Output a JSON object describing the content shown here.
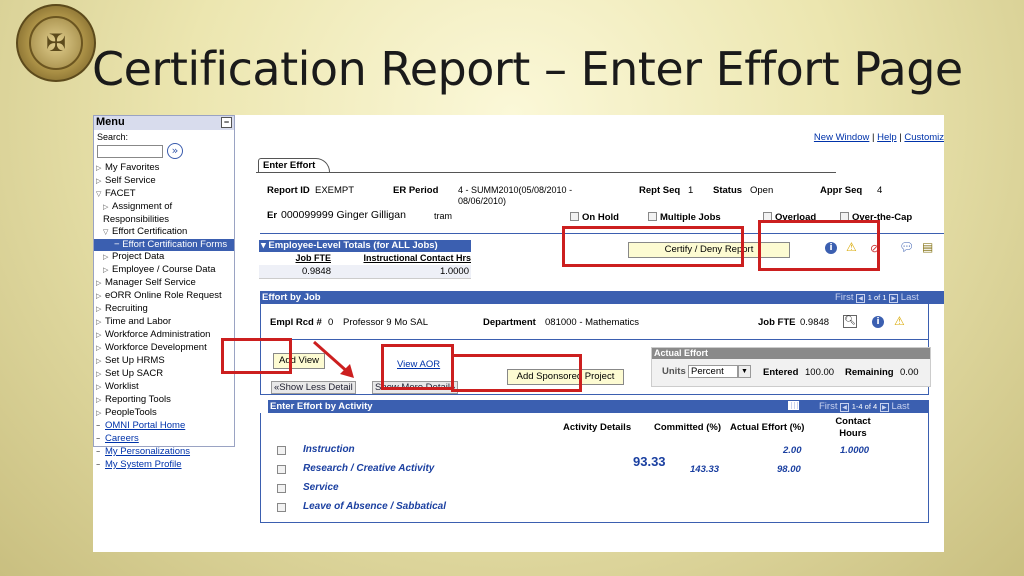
{
  "slide": {
    "title": "Certification Report – Enter Effort Page"
  },
  "menu": {
    "title": "Menu",
    "search_label": "Search:",
    "items": [
      "My Favorites",
      "Self Service",
      "FACET",
      "Assignment of Responsibilities",
      "Effort Certification",
      "Effort Certification Forms",
      "Project Data",
      "Employee / Course Data",
      "Manager Self Service",
      "eORR Online Role Request",
      "Recruiting",
      "Time and Labor",
      "Workforce Administration",
      "Workforce Development",
      "Set Up HRMS",
      "Set Up SACR",
      "Worklist",
      "Reporting Tools",
      "PeopleTools",
      "OMNI Portal Home",
      "Careers",
      "My Personalizations",
      "My System Profile"
    ]
  },
  "top_links": {
    "new_window": "New Window",
    "help": "Help",
    "customize": "Customiz",
    "sep": "|"
  },
  "tab": "Enter Effort",
  "header": {
    "report_id_label": "Report ID",
    "report_id": "EXEMPT",
    "er_period_label": "ER Period",
    "er_period": "4 - SUMM2010(05/08/2010 - 08/06/2010)",
    "rept_seq_label": "Rept Seq",
    "rept_seq": "1",
    "status_label": "Status",
    "status": "Open",
    "appr_seq_label": "Appr Seq",
    "appr_seq": "4",
    "emp_label": "Er",
    "emp_id": "000099999 Ginger Gilligan",
    "emp_suffix": "tram",
    "on_hold": "On Hold",
    "multiple_jobs": "Multiple Jobs",
    "overload": "Overload",
    "over_cap": "Over-the-Cap"
  },
  "totals": {
    "title": "Employee-Level Totals (for ALL Jobs)",
    "col1": "Job FTE",
    "col2": "Instructional Contact Hrs",
    "val1": "0.9848",
    "val2": "1.0000"
  },
  "certify_button": "Certify / Deny Report",
  "effort_by_job": {
    "title": "Effort by Job",
    "pager_first": "First",
    "pager_count": "1 of 1",
    "pager_last": "Last",
    "empl_rcd_label": "Empl Rcd #",
    "empl_rcd": "0",
    "job_title": "Professor 9 Mo SAL",
    "department_label": "Department",
    "department": "081000 - Mathematics",
    "job_fte_label": "Job FTE",
    "job_fte": "0.9848"
  },
  "buttons": {
    "add_view": "Add View",
    "view_aor": "View AOR",
    "add_sponsored": "Add Sponsored Project",
    "show_less": "Show Less Detail",
    "show_more": "Show More Detail"
  },
  "actual_effort": {
    "title": "Actual Effort",
    "units_label": "Units",
    "units": "Percent",
    "entered_label": "Entered",
    "entered": "100.00",
    "remaining_label": "Remaining",
    "remaining": "0.00"
  },
  "activity": {
    "title": "Enter Effort by Activity",
    "pager_first": "First",
    "pager_count": "1-4 of 4",
    "pager_last": "Last",
    "cols": {
      "details": "Activity Details",
      "committed": "Committed (%)",
      "actual": "Actual Effort (%)",
      "contact": "Contact Hours"
    },
    "rows": [
      {
        "name": "Instruction",
        "committed": "",
        "actual": "2.00",
        "contact": "1.0000"
      },
      {
        "name": "Research / Creative Activity",
        "committed": "143.33",
        "actual": "98.00",
        "contact": ""
      },
      {
        "name": "Service",
        "committed": "",
        "actual": "",
        "contact": ""
      },
      {
        "name": "Leave of Absence / Sabbatical",
        "committed": "",
        "actual": "",
        "contact": ""
      }
    ],
    "overlay_value": "93.33"
  },
  "colors": {
    "highlight_box": "#cc1f1f",
    "header_blue": "#3b5fb0"
  }
}
